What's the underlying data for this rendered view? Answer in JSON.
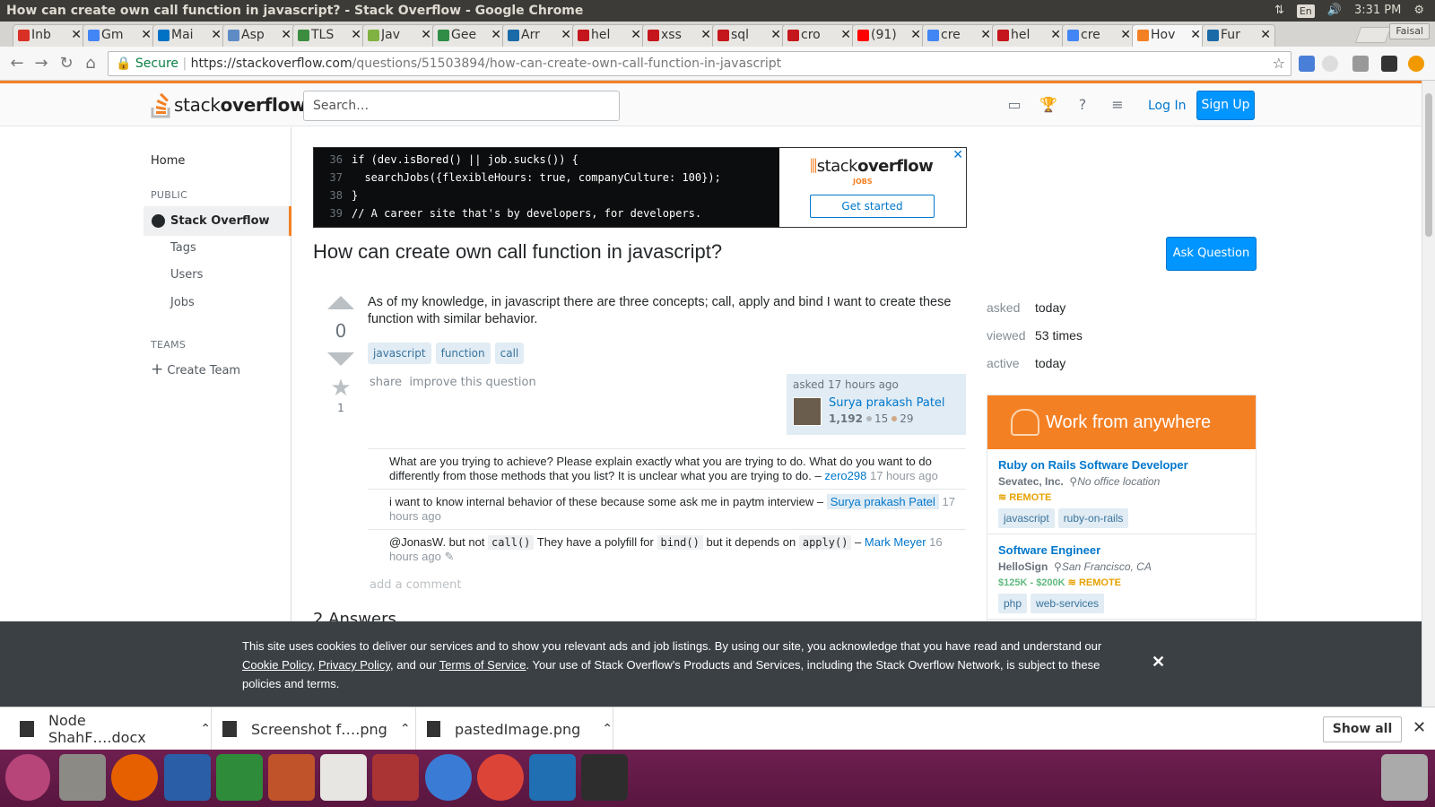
{
  "window": {
    "title": "How can create own call function in javascript? - Stack Overflow - Google Chrome",
    "lang": "En",
    "time": "3:31 PM",
    "profile": "Faisal"
  },
  "tabs": [
    {
      "label": "Inb",
      "color": "#d93025"
    },
    {
      "label": "Gm",
      "color": "#4285f4"
    },
    {
      "label": "Mai",
      "color": "#0072c6"
    },
    {
      "label": "Asp",
      "color": "#5e8bc4"
    },
    {
      "label": "TLS",
      "color": "#3c8d40"
    },
    {
      "label": "Jav",
      "color": "#7fb241"
    },
    {
      "label": "Gee",
      "color": "#2f8d46"
    },
    {
      "label": "Arr",
      "color": "#1a6aa8"
    },
    {
      "label": "hel",
      "color": "#c4161c"
    },
    {
      "label": "xss",
      "color": "#c4161c"
    },
    {
      "label": "sql",
      "color": "#c4161c"
    },
    {
      "label": "cro",
      "color": "#c4161c"
    },
    {
      "label": "(91)",
      "color": "#ff0000"
    },
    {
      "label": "cre",
      "color": "#4285f4"
    },
    {
      "label": "hel",
      "color": "#c4161c"
    },
    {
      "label": "cre",
      "color": "#4285f4"
    },
    {
      "label": "Hov",
      "color": "#f48024"
    },
    {
      "label": "Fur",
      "color": "#1a6aa8"
    }
  ],
  "address": {
    "secure": "Secure",
    "url_host": "https://stackoverflow.com",
    "url_path": "/questions/51503894/how-can-create-own-call-function-in-javascript"
  },
  "header": {
    "logo_a": "stack",
    "logo_b": "overflow",
    "search_placeholder": "Search…",
    "login": "Log In",
    "signup": "Sign Up"
  },
  "nav": {
    "home": "Home",
    "public": "PUBLIC",
    "so": "Stack Overflow",
    "tags": "Tags",
    "users": "Users",
    "jobs": "Jobs",
    "teams": "TEAMS",
    "create_team": "Create Team"
  },
  "ad": {
    "lines": [
      {
        "n": "36",
        "code": "if (dev.isBored() || job.sucks()) {"
      },
      {
        "n": "37",
        "code": "  searchJobs({flexibleHours: true, companyCulture: 100});"
      },
      {
        "n": "38",
        "code": "}"
      },
      {
        "n": "39",
        "code": "// A career site that's by developers, for developers."
      }
    ],
    "logo_a": "stack",
    "logo_b": "overflow",
    "jobs": "JOBS",
    "cta": "Get started"
  },
  "question": {
    "title": "How can create own call function in javascript?",
    "ask_button": "Ask Question",
    "votes": "0",
    "favorites": "1",
    "body": "As of my knowledge, in javascript there are three concepts; call, apply and bind I want to create these function with similar behavior.",
    "tags": [
      "javascript",
      "function",
      "call"
    ],
    "share": "share",
    "improve": "improve this question",
    "asked": "asked 17 hours ago",
    "user": "Surya prakash Patel",
    "rep": "1,192",
    "silver": "15",
    "bronze": "29",
    "add_comment": "add a comment",
    "answers": "2 Answers"
  },
  "comments": [
    {
      "text": "What are you trying to achieve? Please explain exactly what you are trying to do. What do you want to do differently from those methods that you list? It is unclear what you are trying to do. –",
      "user": "zero298",
      "time": "17 hours ago"
    },
    {
      "text": "i want to know internal behavior of these because some ask me in paytm interview –",
      "user": "Surya prakash Patel",
      "time": "17 hours ago"
    },
    {
      "pre": "@JonasW. but not",
      "c1": "call()",
      "mid1": "They have a polyfill for",
      "c2": "bind()",
      "mid2": "but it depends on",
      "c3": "apply()",
      "user": "Mark Meyer",
      "time": "16 hours ago"
    }
  ],
  "stats": {
    "asked_k": "asked",
    "asked_v": "today",
    "viewed_k": "viewed",
    "viewed_v": "53 times",
    "active_k": "active",
    "active_v": "today"
  },
  "jobs": {
    "heading": "Work from anywhere",
    "items": [
      {
        "title": "Ruby on Rails Software Developer",
        "company": "Sevatec, Inc.",
        "location": "No office location",
        "salary": "",
        "remote": "REMOTE",
        "tags": [
          "javascript",
          "ruby-on-rails"
        ]
      },
      {
        "title": "Software Engineer",
        "company": "HelloSign",
        "location": "San Francisco, CA",
        "salary": "$125K - $200K",
        "remote": "REMOTE",
        "tags": [
          "php",
          "web-services"
        ]
      }
    ]
  },
  "cookie": {
    "t1": "This site uses cookies to deliver our services and to show you relevant ads and job listings. By using our site, you acknowledge that you have read and understand our",
    "l1": "Cookie Policy",
    "l2": "Privacy Policy",
    "t2": ", and our",
    "l3": "Terms of Service",
    "t3": ". Your use of Stack Overflow's Products and Services, including the Stack Overflow Network, is subject to these policies and terms."
  },
  "downloads": {
    "items": [
      "Node ShahF….docx",
      "Screenshot f….png",
      "pastedImage.png"
    ],
    "show_all": "Show all"
  }
}
